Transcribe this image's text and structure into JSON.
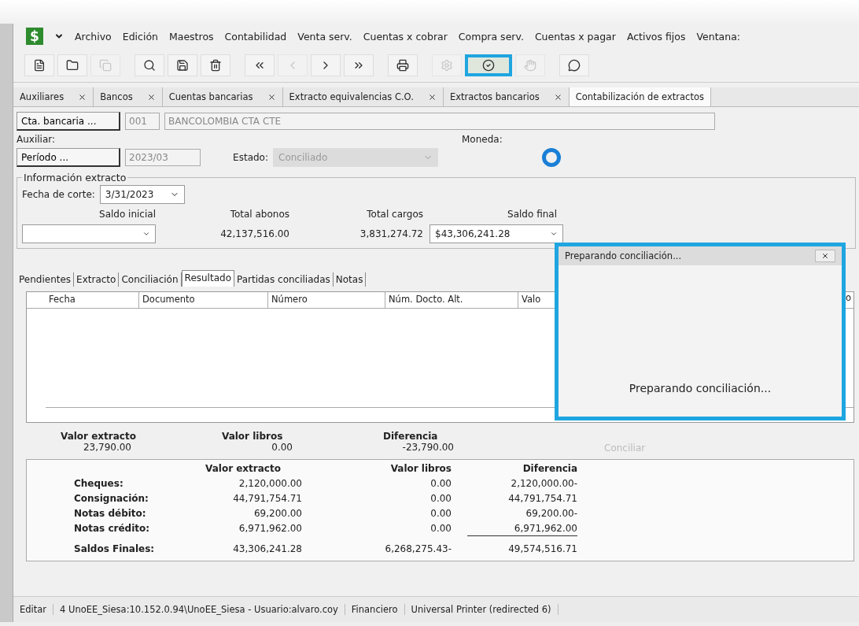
{
  "menu": {
    "app_logo": "$",
    "items": [
      "Archivo",
      "Edición",
      "Maestros",
      "Contabilidad",
      "Venta serv.",
      "Cuentas x cobrar",
      "Compra serv.",
      "Cuentas x pagar",
      "Activos fijos",
      "Ventana:"
    ]
  },
  "toolbar": [
    {
      "kind": "new",
      "disabled": false,
      "highlighted": false
    },
    {
      "kind": "open",
      "disabled": false,
      "highlighted": false
    },
    {
      "kind": "copy",
      "disabled": true,
      "highlighted": false
    },
    {
      "kind": "sep"
    },
    {
      "kind": "search",
      "disabled": false,
      "highlighted": false
    },
    {
      "kind": "save",
      "disabled": false,
      "highlighted": false
    },
    {
      "kind": "delete",
      "disabled": false,
      "highlighted": false
    },
    {
      "kind": "sep"
    },
    {
      "kind": "first",
      "disabled": false,
      "highlighted": false
    },
    {
      "kind": "prev",
      "disabled": true,
      "highlighted": false
    },
    {
      "kind": "next",
      "disabled": false,
      "highlighted": false
    },
    {
      "kind": "last",
      "disabled": false,
      "highlighted": false
    },
    {
      "kind": "sep"
    },
    {
      "kind": "print",
      "disabled": false,
      "highlighted": false
    },
    {
      "kind": "sep"
    },
    {
      "kind": "settings",
      "disabled": true,
      "highlighted": false
    },
    {
      "kind": "reconcile",
      "disabled": false,
      "highlighted": true
    },
    {
      "kind": "hand",
      "disabled": true,
      "highlighted": false
    },
    {
      "kind": "sep"
    },
    {
      "kind": "help",
      "disabled": false,
      "highlighted": false
    }
  ],
  "doc_tabs": [
    {
      "label": "Auxiliares",
      "selected": false
    },
    {
      "label": "Bancos",
      "selected": false
    },
    {
      "label": "Cuentas bancarias",
      "selected": false
    },
    {
      "label": "Extracto equivalencias C.O.",
      "selected": false
    },
    {
      "label": "Extractos bancarios",
      "selected": false
    },
    {
      "label": "Contabilización de extractos",
      "selected": true
    }
  ],
  "form": {
    "account_button": "Cta. bancaria ...",
    "account_code": "001",
    "account_name": "BANCOLOMBIA CTA CTE",
    "auxiliar_label": "Auxiliar:",
    "moneda_label": "Moneda:",
    "period_button": "Período ...",
    "period_value": "2023/03",
    "estado_label": "Estado:",
    "estado_value": "Conciliado"
  },
  "statement": {
    "title": "Información extracto",
    "cutoff_label": "Fecha de corte:",
    "cutoff_value": "3/31/2023",
    "saldo_inicial_label": "Saldo inicial",
    "total_abonos_label": "Total abonos",
    "total_abonos": "42,137,516.00",
    "total_cargos_label": "Total cargos",
    "total_cargos": "3,831,274.72",
    "saldo_final_label": "Saldo final",
    "saldo_final": "$43,306,241.28"
  },
  "tabs": [
    {
      "label": "Pendientes",
      "selected": false
    },
    {
      "label": "Extracto",
      "selected": false
    },
    {
      "label": "Conciliación",
      "selected": false
    },
    {
      "label": "Resultado",
      "selected": true
    },
    {
      "label": "Partidas conciliadas",
      "selected": false
    },
    {
      "label": "Notas",
      "selected": false
    }
  ],
  "grid": {
    "columns": [
      "Fecha",
      "Documento",
      "Número",
      "Núm. Docto. Alt.",
      "Valo"
    ],
    "column_end": "o"
  },
  "totals": {
    "items": [
      {
        "label": "Valor extracto",
        "value": "23,790.00"
      },
      {
        "label": "Valor libros",
        "value": "0.00"
      },
      {
        "label": "Diferencia",
        "value": "-23,790.00"
      }
    ],
    "conciliar_button": "Conciliar"
  },
  "summary": {
    "columns": [
      "Valor extracto",
      "Valor libros",
      "Diferencia"
    ],
    "rows": [
      {
        "label": "Cheques:",
        "values": [
          "2,120,000.00",
          "0.00",
          "2,120,000.00-"
        ]
      },
      {
        "label": "Consignación:",
        "values": [
          "44,791,754.71",
          "0.00",
          "44,791,754.71"
        ]
      },
      {
        "label": "Notas débito:",
        "values": [
          "69,200.00",
          "0.00",
          "69,200.00-"
        ]
      },
      {
        "label": "Notas crédito:",
        "values": [
          "6,971,962.00",
          "0.00",
          "6,971,962.00"
        ]
      },
      {
        "label": "Saldos Finales:",
        "values": [
          "43,306,241.28",
          "6,268,275.43-",
          "49,574,516.71"
        ]
      }
    ]
  },
  "dialog": {
    "title": "Preparando conciliación...",
    "message": "Preparando conciliación..."
  },
  "status_bar": [
    "Editar",
    "4 UnoEE_Siesa:10.152.0.94\\UnoEE_Siesa - Usuario:alvaro.coy",
    "Financiero",
    "Universal Printer  (redirected 6)"
  ]
}
